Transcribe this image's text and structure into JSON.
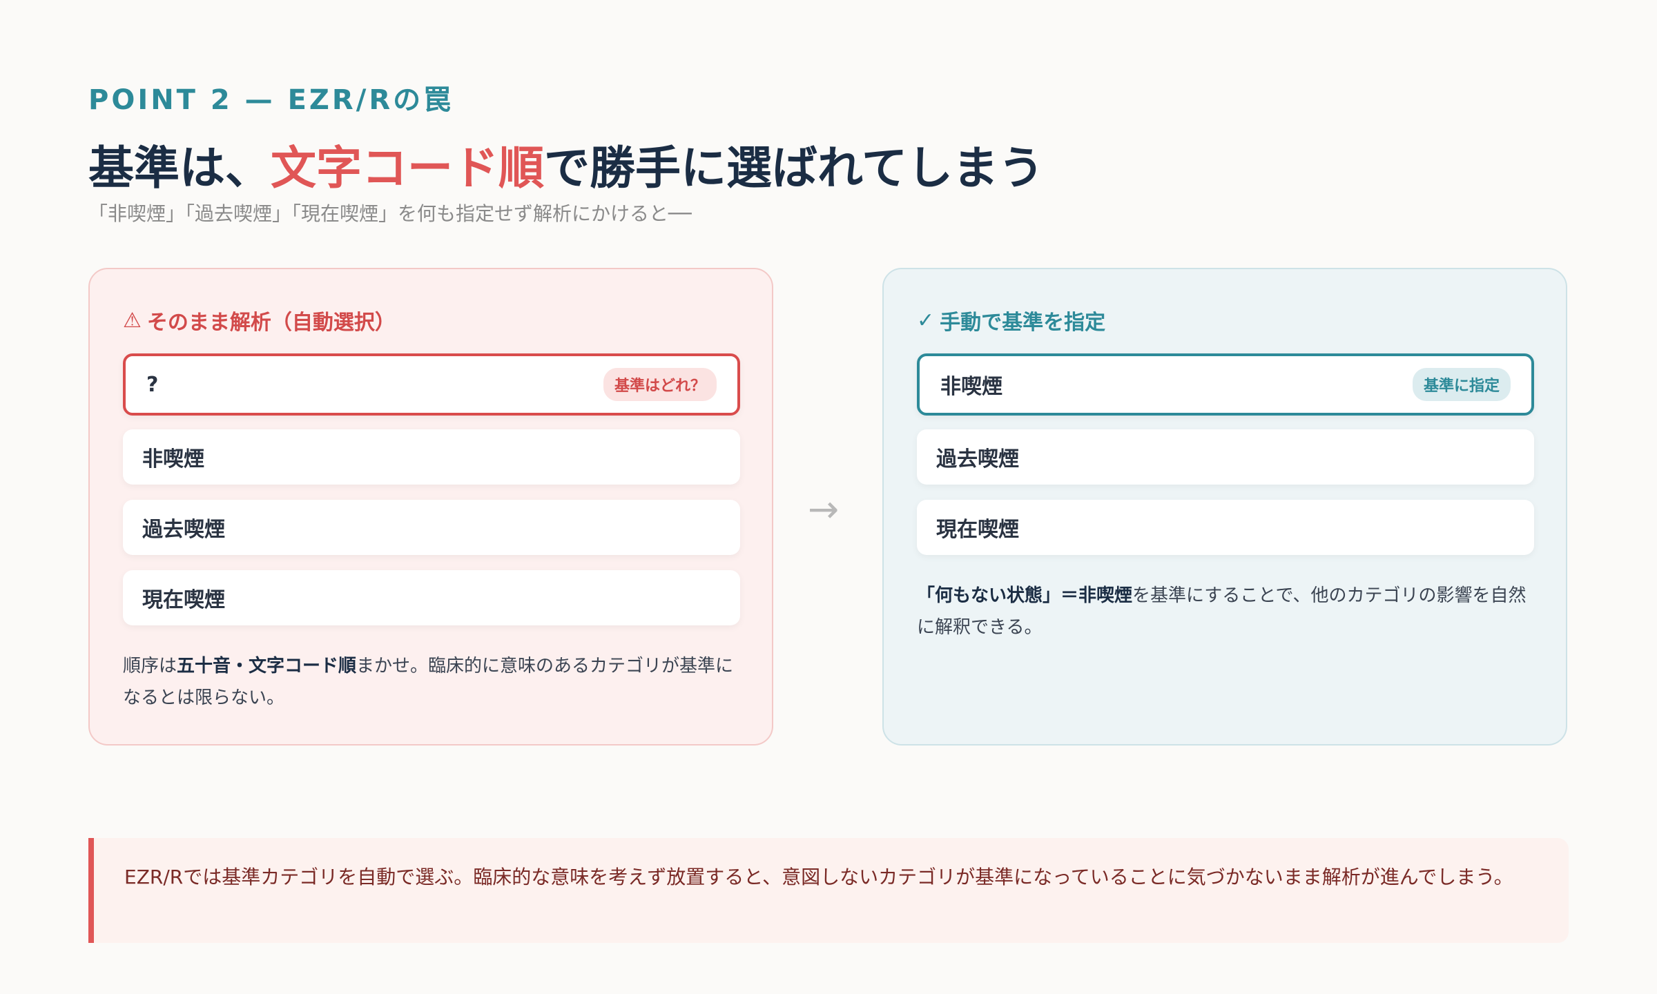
{
  "header": {
    "eyebrow": "POINT 2 — EZR/Rの罠",
    "title_before": "基準は、",
    "title_highlight": "文字コード順",
    "title_after": "で勝手に選ばれてしまう",
    "subtitle": "「非喫煙」「過去喫煙」「現在喫煙」を何も指定せず解析にかけると──"
  },
  "left_panel": {
    "icon": "warning-icon",
    "heading": "そのまま解析（自動選択）",
    "selected": {
      "label": "?",
      "badge": "基準はどれ？"
    },
    "items": [
      "非喫煙",
      "過去喫煙",
      "現在喫煙"
    ],
    "note_pre": "順序は",
    "note_bold": "五十音・文字コード順",
    "note_post": "まかせ。臨床的に意味のあるカテゴリが基準になるとは限らない。"
  },
  "right_panel": {
    "icon": "check-icon",
    "heading": "手動で基準を指定",
    "selected": {
      "label": "非喫煙",
      "badge": "基準に指定"
    },
    "items": [
      "過去喫煙",
      "現在喫煙"
    ],
    "note_bold": "「何もない状態」＝非喫煙",
    "note_post": "を基準にすることで、他のカテゴリの影響を自然に解釈できる。"
  },
  "arrow_icon": "arrow-right-icon",
  "callout": {
    "text": "EZR/Rでは基準カテゴリを自動で選ぶ。臨床的な意味を考えず放置すると、意図しないカテゴリが基準になっていることに気づかないまま解析が進んでしまう。"
  },
  "colors": {
    "accent_teal": "#2d8a99",
    "accent_red": "#e05656",
    "title_navy": "#1b2d44"
  }
}
